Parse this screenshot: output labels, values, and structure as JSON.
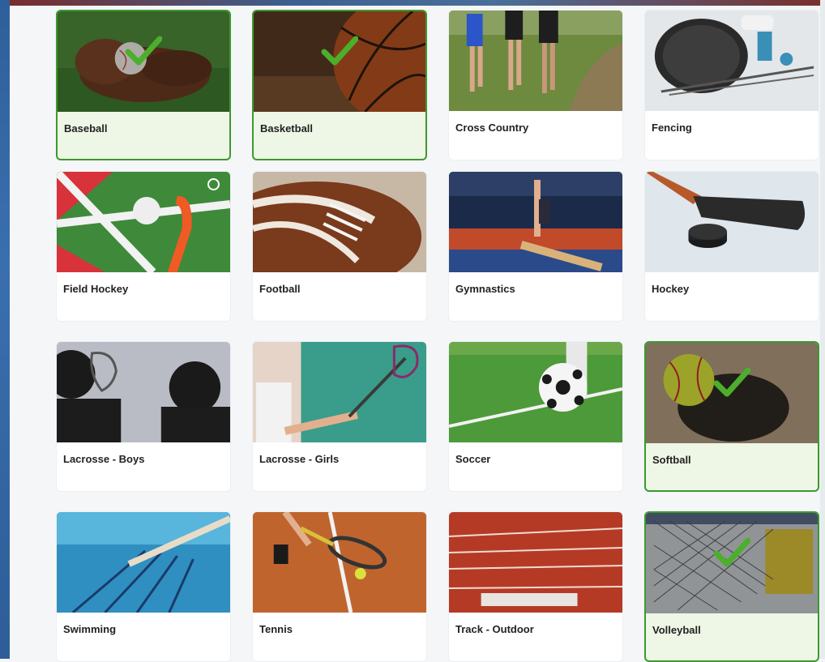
{
  "sports": [
    {
      "label": "Baseball",
      "selected": true,
      "icon": "baseball-glove-icon"
    },
    {
      "label": "Basketball",
      "selected": true,
      "icon": "basketball-icon"
    },
    {
      "label": "Cross Country",
      "selected": false,
      "icon": "runners-icon"
    },
    {
      "label": "Fencing",
      "selected": false,
      "icon": "fencing-mask-icon"
    },
    {
      "label": "Field Hockey",
      "selected": false,
      "icon": "field-hockey-icon"
    },
    {
      "label": "Football",
      "selected": false,
      "icon": "football-icon"
    },
    {
      "label": "Gymnastics",
      "selected": false,
      "icon": "gymnastics-icon"
    },
    {
      "label": "Hockey",
      "selected": false,
      "icon": "hockey-stick-icon"
    },
    {
      "label": "Lacrosse - Boys",
      "selected": false,
      "icon": "lacrosse-boys-icon"
    },
    {
      "label": "Lacrosse - Girls",
      "selected": false,
      "icon": "lacrosse-girls-icon"
    },
    {
      "label": "Soccer",
      "selected": false,
      "icon": "soccer-ball-icon"
    },
    {
      "label": "Softball",
      "selected": true,
      "icon": "softball-icon"
    },
    {
      "label": "Swimming",
      "selected": false,
      "icon": "pool-icon"
    },
    {
      "label": "Tennis",
      "selected": false,
      "icon": "tennis-icon"
    },
    {
      "label": "Track - Outdoor",
      "selected": false,
      "icon": "track-icon"
    },
    {
      "label": "Volleyball",
      "selected": true,
      "icon": "volleyball-net-icon"
    }
  ],
  "colors": {
    "selected_border": "#3b9a2d",
    "selected_bg": "#eef6e6",
    "check": "#4caf2c"
  }
}
